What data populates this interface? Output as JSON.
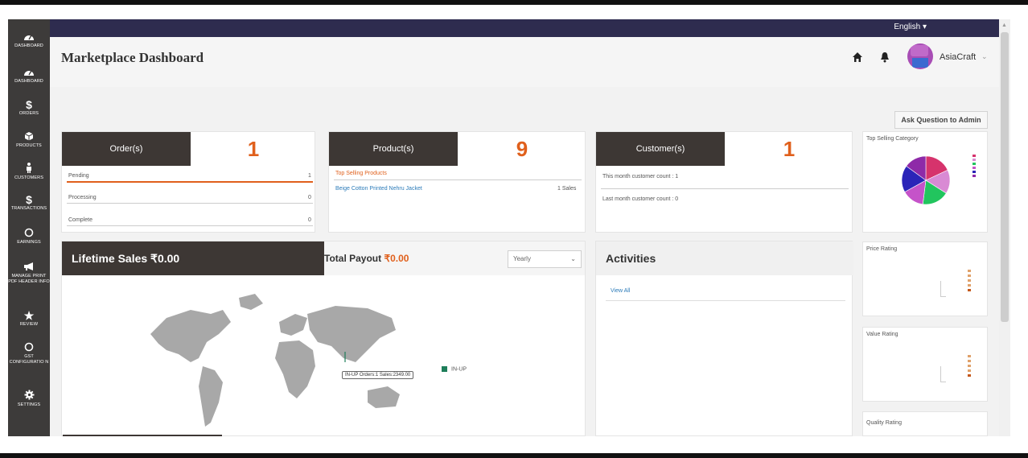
{
  "topbar": {
    "language": "English ▾"
  },
  "sidebar": {
    "items": [
      {
        "icon": "dashboard-icon",
        "label": "DASHBOARD"
      },
      {
        "icon": "dashboard-icon",
        "label": "DASHBOARD"
      },
      {
        "icon": "dollar-icon",
        "label": "ORDERS"
      },
      {
        "icon": "box-icon",
        "label": "PRODUCTS"
      },
      {
        "icon": "person-icon",
        "label": "CUSTOMERS"
      },
      {
        "icon": "dollar-icon",
        "label": "TRANSACTIONS"
      },
      {
        "icon": "circle-icon",
        "label": "EARNINGS"
      },
      {
        "icon": "megaphone-icon",
        "label": "MANAGE PRINT PDF HEADER INFO"
      },
      {
        "icon": "star-icon",
        "label": "REVIEW"
      },
      {
        "icon": "circle-icon",
        "label": "GST CONFIGURATIO N"
      },
      {
        "icon": "gear-icon",
        "label": "SETTINGS"
      }
    ]
  },
  "header": {
    "title": "Marketplace Dashboard",
    "user": "AsiaCraft",
    "user_caret": "⌄"
  },
  "ask_button": "Ask Question to Admin",
  "orders_card": {
    "heading": "Order(s)",
    "count": "1",
    "rows": [
      {
        "label": "Pending",
        "value": "1"
      },
      {
        "label": "Processing",
        "value": "0"
      },
      {
        "label": "Complete",
        "value": "0"
      }
    ]
  },
  "products_card": {
    "heading": "Product(s)",
    "count": "9",
    "top_label": "Top Selling Products",
    "product_name": "Beige Cotton Printed Nehru Jacket",
    "product_sales": "1 Sales"
  },
  "customers_card": {
    "heading": "Customer(s)",
    "count": "1",
    "this_month": "This month customer count : 1",
    "last_month": "Last month customer count : 0"
  },
  "sales": {
    "lifetime": "Lifetime Sales ₹0.00",
    "payout_label": "Total Payout",
    "payout_value": "₹0.00",
    "period": "Yearly",
    "legend": "IN-UP",
    "tooltip": "IN-UP Orders:1 Sales:2349.00"
  },
  "activities": {
    "heading": "Activities",
    "view_all": "View All"
  },
  "right_panels": {
    "top_selling": "Top Selling Category",
    "price_rating": "Price Rating",
    "value_rating": "Value Rating",
    "quality_rating": "Quality Rating"
  },
  "colors": {
    "sidebar": "#3d3b3a",
    "navbar": "#2e2c4f",
    "accent": "#e0601c",
    "link": "#2b7bb9",
    "dark_header": "#3d3734"
  },
  "chart_data": {
    "type": "pie",
    "title": "Top Selling Category",
    "series": [
      {
        "values": [
          18,
          16,
          18,
          15,
          18,
          15
        ]
      }
    ],
    "colors": [
      "#d6336c",
      "#d98ad4",
      "#22c55e",
      "#c553c9",
      "#2b24b8",
      "#8e2aa8"
    ]
  }
}
